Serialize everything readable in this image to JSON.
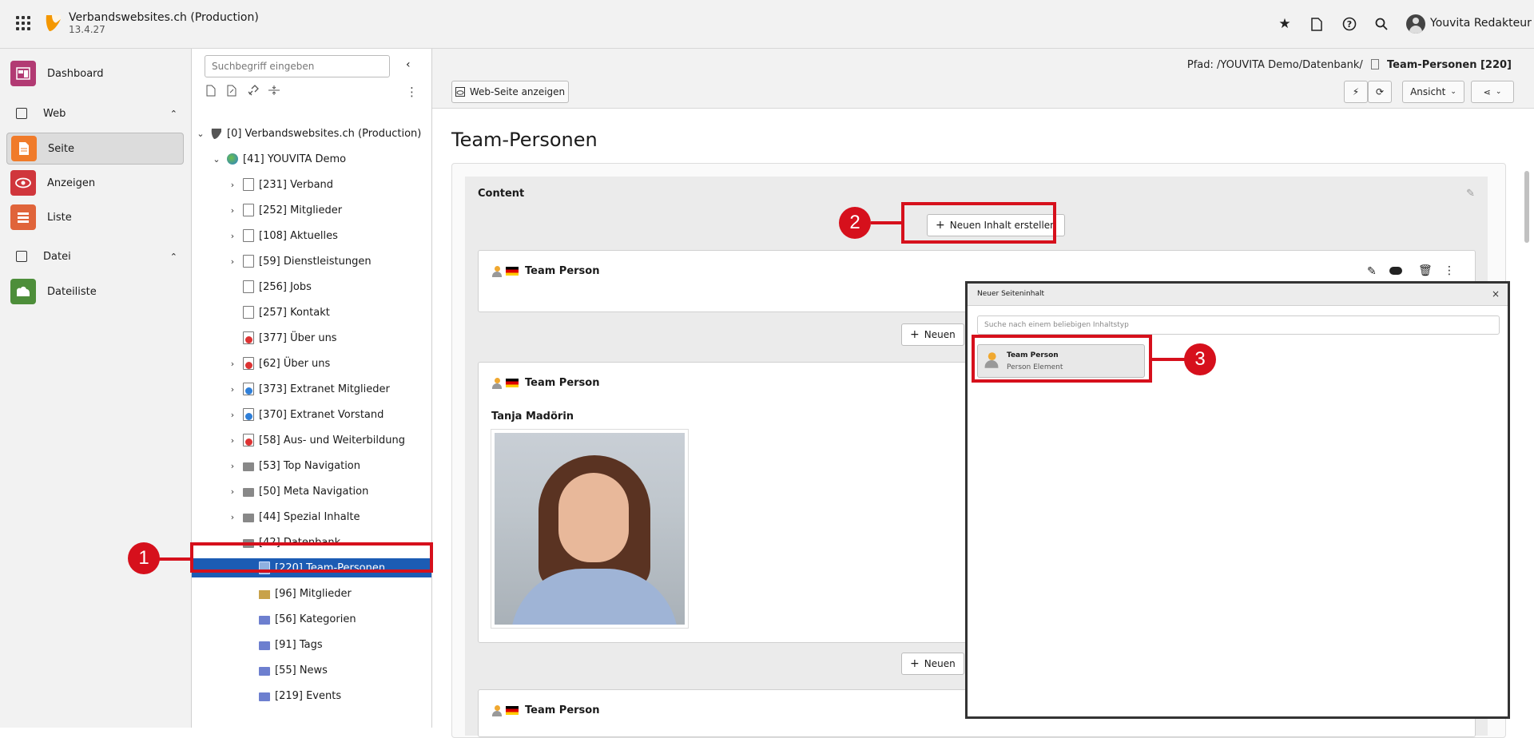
{
  "topbar": {
    "site_name": "Verbandswebsites.ch (Production)",
    "version": "13.4.27",
    "user_name": "Youvita Redakteur",
    "icons": [
      "bookmark-icon",
      "page-icon",
      "help-icon",
      "search-icon",
      "user-avatar"
    ]
  },
  "modules": {
    "dashboard": "Dashboard",
    "web_group": "Web",
    "seite": "Seite",
    "anzeigen": "Anzeigen",
    "liste": "Liste",
    "datei_group": "Datei",
    "dateiliste": "Dateiliste"
  },
  "tree": {
    "search_placeholder": "Suchbegriff eingeben",
    "nodes": [
      {
        "label": "[0] Verbandswebsites.ch (Production)"
      },
      {
        "label": "[41] YOUVITA Demo"
      },
      {
        "label": "[231] Verband"
      },
      {
        "label": "[252] Mitglieder"
      },
      {
        "label": "[108] Aktuelles"
      },
      {
        "label": "[59] Dienstleistungen"
      },
      {
        "label": "[256] Jobs"
      },
      {
        "label": "[257] Kontakt"
      },
      {
        "label": "[377] Über uns"
      },
      {
        "label": "[62] Über uns"
      },
      {
        "label": "[373] Extranet Mitglieder"
      },
      {
        "label": "[370] Extranet Vorstand"
      },
      {
        "label": "[58] Aus- und Weiterbildung"
      },
      {
        "label": "[53] Top Navigation"
      },
      {
        "label": "[50] Meta Navigation"
      },
      {
        "label": "[44] Spezial Inhalte"
      },
      {
        "label": "[42] Datenbank"
      },
      {
        "label": "[220] Team-Personen"
      },
      {
        "label": "[96] Mitglieder"
      },
      {
        "label": "[56] Kategorien"
      },
      {
        "label": "[91] Tags"
      },
      {
        "label": "[55] News"
      },
      {
        "label": "[219] Events"
      }
    ]
  },
  "docheader": {
    "path_label": "Pfad: /YOUVITA Demo/Datenbank/",
    "path_page": "Team-Personen [220]",
    "view_button": "Web-Seite anzeigen",
    "ansicht": "Ansicht"
  },
  "page": {
    "title": "Team-Personen",
    "column_title": "Content",
    "new_content": "Neuen Inhalt erstellen",
    "new_content_short": "Neuen",
    "elements": [
      {
        "type": "Team Person"
      },
      {
        "type": "Team Person",
        "name": "Tanja Madörin"
      },
      {
        "type": "Team Person"
      }
    ]
  },
  "modal": {
    "title": "Neuer Seiteninhalt",
    "search_placeholder": "Suche nach einem beliebigen Inhaltstyp",
    "item_title": "Team Person",
    "item_subtitle": "Person Element"
  },
  "annotations": {
    "m1": "1",
    "m2": "2",
    "m3": "3",
    "color": "#d6101c"
  }
}
